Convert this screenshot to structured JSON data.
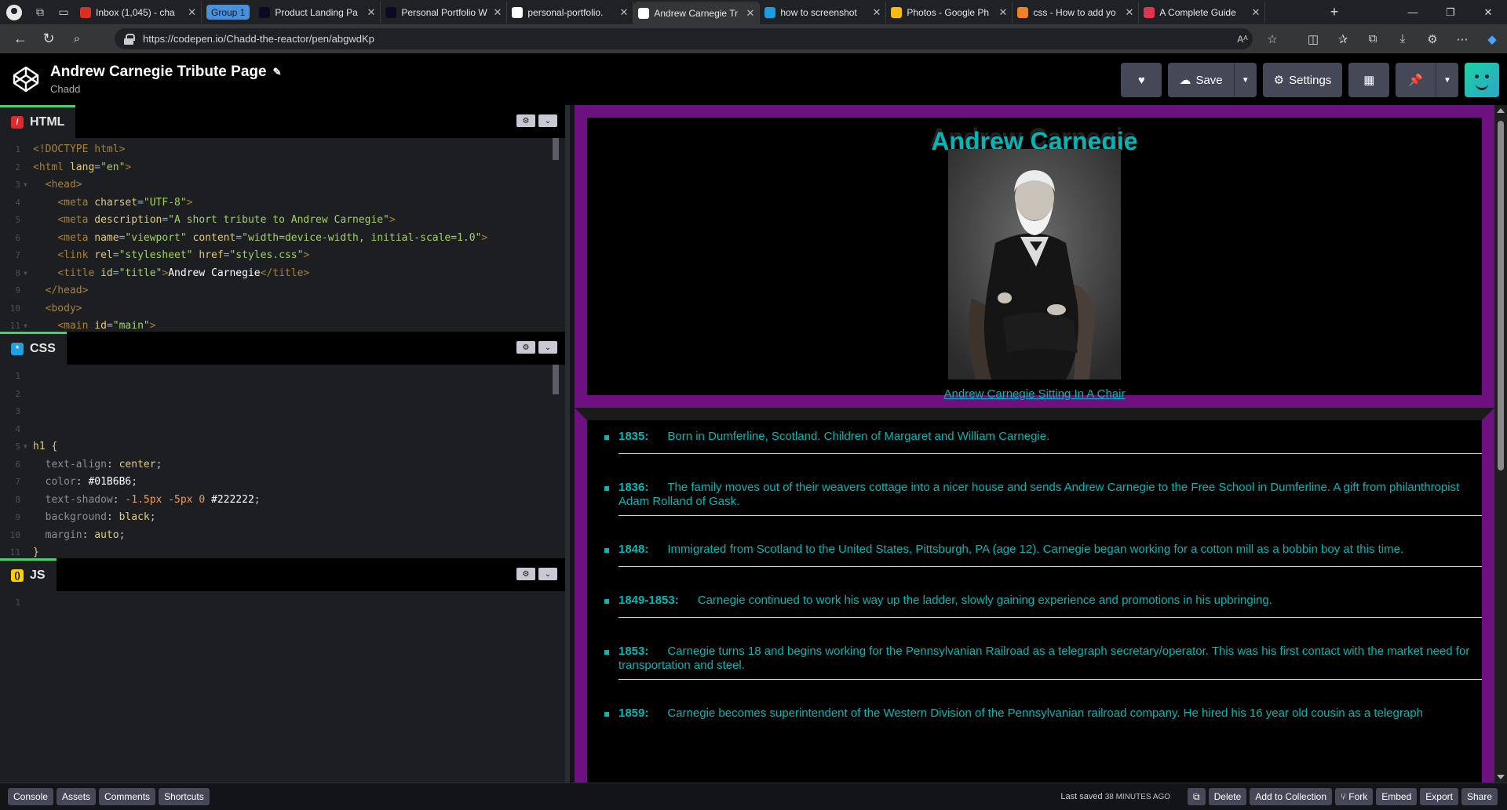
{
  "browser": {
    "tabs": [
      {
        "title": "Inbox (1,045) - cha",
        "icon": "gmail-icon",
        "color": "#d93025"
      },
      {
        "title": "Product Landing Pa",
        "icon": "fcc-icon",
        "color": "#0a0a23"
      },
      {
        "title": "Personal Portfolio W",
        "icon": "fcc-icon",
        "color": "#0a0a23"
      },
      {
        "title": "personal-portfolio.",
        "icon": "file-icon",
        "color": "#ffffff"
      },
      {
        "title": "Andrew Carnegie Tr",
        "icon": "codepen-icon",
        "color": "#ffffff",
        "active": true
      },
      {
        "title": "how to screenshot",
        "icon": "bing-icon",
        "color": "#1b9de2"
      },
      {
        "title": "Photos - Google Ph",
        "icon": "photos-icon",
        "color": "#fbbc04"
      },
      {
        "title": "css - How to add yo",
        "icon": "stackoverflow-icon",
        "color": "#f48024"
      },
      {
        "title": "A Complete Guide",
        "icon": "csstricks-icon",
        "color": "#e0334e"
      }
    ],
    "group_label": "Group 1",
    "url": "https://codepen.io/Chadd-the-reactor/pen/abgwdKp"
  },
  "codepen": {
    "pen_title": "Andrew Carnegie Tribute Page",
    "author": "Chadd",
    "save_label": "Save",
    "settings_label": "Settings"
  },
  "editors": {
    "html_label": "HTML",
    "css_label": "CSS",
    "js_label": "JS",
    "html_lines": [
      "<!DOCTYPE html>",
      "<html lang=\"en\">",
      "  <head>",
      "    <meta charset=\"UTF-8\">",
      "    <meta description=\"A short tribute to Andrew Carnegie\">",
      "    <meta name=\"viewport\" content=\"width=device-width, initial-scale=1.0\">",
      "    <link rel=\"stylesheet\" href=\"styles.css\">",
      "    <title id=\"title\">Andrew Carnegie</title>",
      "  </head>",
      "  <body>",
      "    <main id=\"main\">"
    ],
    "css_lines": [
      "",
      "",
      "",
      "",
      "h1 {",
      "  text-align: center;",
      "  color: #01B6B6;",
      "  text-shadow: -1.5px -5px 0 #222222;",
      "  background: black;",
      "  margin: auto;",
      "}"
    ],
    "js_lines": [
      ""
    ]
  },
  "preview": {
    "heading": "Andrew Carnegie",
    "caption": "Andrew Carnegie Sitting In A Chair",
    "accent_color": "#01B6B6",
    "border_color": "#6D1180",
    "timeline": [
      {
        "year": "1835:",
        "text": "Born in Dumferline, Scotland. Children of Margaret and William Carnegie."
      },
      {
        "year": "1836:",
        "text": "The family moves out of their weavers cottage into a nicer house and sends Andrew Carnegie to the Free School in Dumferline. A gift from philanthropist Adam Rolland of Gask."
      },
      {
        "year": "1848:",
        "text": "Immigrated from Scotland to the United States, Pittsburgh, PA (age 12). Carnegie began working for a cotton mill as a bobbin boy at this time."
      },
      {
        "year": "1849-1853:",
        "text": "Carnegie continued to work his way up the ladder, slowly gaining experience and promotions in his upbringing."
      },
      {
        "year": "1853:",
        "text": "Carnegie turns 18 and begins working for the Pennsylvanian Railroad as a telegraph secretary/operator. This was his first contact with the market need for transportation and steel."
      },
      {
        "year": "1859:",
        "text": "Carnegie becomes superintendent of the Western Division of the Pennsylvanian railroad company. He hired his 16 year old cousin as a telegraph"
      }
    ]
  },
  "footer": {
    "console": "Console",
    "assets": "Assets",
    "comments": "Comments",
    "shortcuts": "Shortcuts",
    "saved_prefix": "Last saved",
    "saved_ago": "38 MINUTES AGO",
    "delete": "Delete",
    "add_collection": "Add to Collection",
    "fork": "Fork",
    "embed": "Embed",
    "export": "Export",
    "share": "Share"
  }
}
